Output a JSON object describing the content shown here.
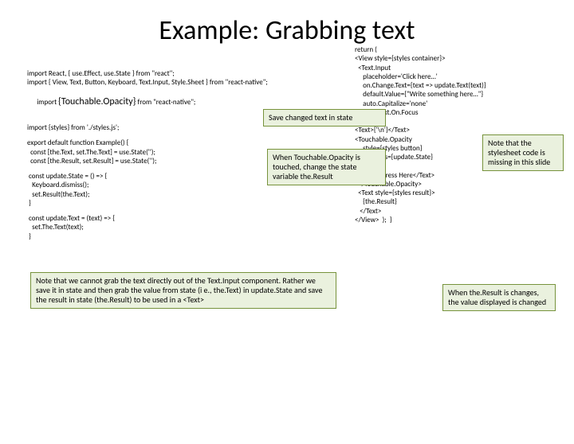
{
  "title": "Example: Grabbing text",
  "left": {
    "l1": "import React, { use.Effect, use.State } from \"react\";",
    "l2": "import { View, Text, Button, Keyboard, Text.Input, Style.Sheet } from \"react-native\";",
    "l3a": "import ",
    "l3b": "{Touchable.Opacity}",
    "l3c": " from \"react-native\";",
    "l4": "import {styles} from './styles.js';",
    "l5": "export default function Example() {",
    "l6": "  const [the.Text, set.The.Text] = use.State('');",
    "l7": "  const [the.Result, set.Result] = use.State('');",
    "l8": " const update.State = () => {",
    "l9": "   Keyboard.dismiss();",
    "l10": "   set.Result(the.Text);",
    "l11": " }",
    "l12": " const update.Text = (text) => {",
    "l13": "   set.The.Text(text);",
    "l14": " }"
  },
  "right": {
    "r1": "return (",
    "r2": "<View style={styles container}>",
    "r3": "  <Text.Input",
    "r4": "     placeholder='Click here…'",
    "r5": "     on.Change.Text={text => update.Text(text)}",
    "r6": "     default.Value={\"Write something here…\"}",
    "r7": "     auto.Capitalize='none'",
    "r8": "     clear.Text.On.Focus",
    "r9": "   />",
    "r10": "<Text>{'\\n'}</Text>",
    "r11": "<Touchable.Opacity",
    "r12": "     style={styles button}",
    "r13": "     on.Press={update.State}",
    "r14": "  >",
    "r15": "     <Text>Press Here</Text>",
    "r16": "  </Touchable.Opacity>",
    "r17": "  <Text style={styles result}>",
    "r18": "     {the.Result}",
    "r19": "   </Text>",
    "r20": "</View>  );  }"
  },
  "callouts": {
    "save": "Save changed text in state",
    "touch": "When Touchable.Opacity is touched, change the state variable the.Result",
    "bottom": "Note that we cannot grab the text directly out of the Text.Input component. Rather we save it in state and then grab the value from state (i e., the.Text) in update.State and save the result in state (the.Result) to be used in a <Text>",
    "style": "Note that the stylesheet code is missing in this slide",
    "result": "When the.Result is changes, the value displayed is changed"
  }
}
